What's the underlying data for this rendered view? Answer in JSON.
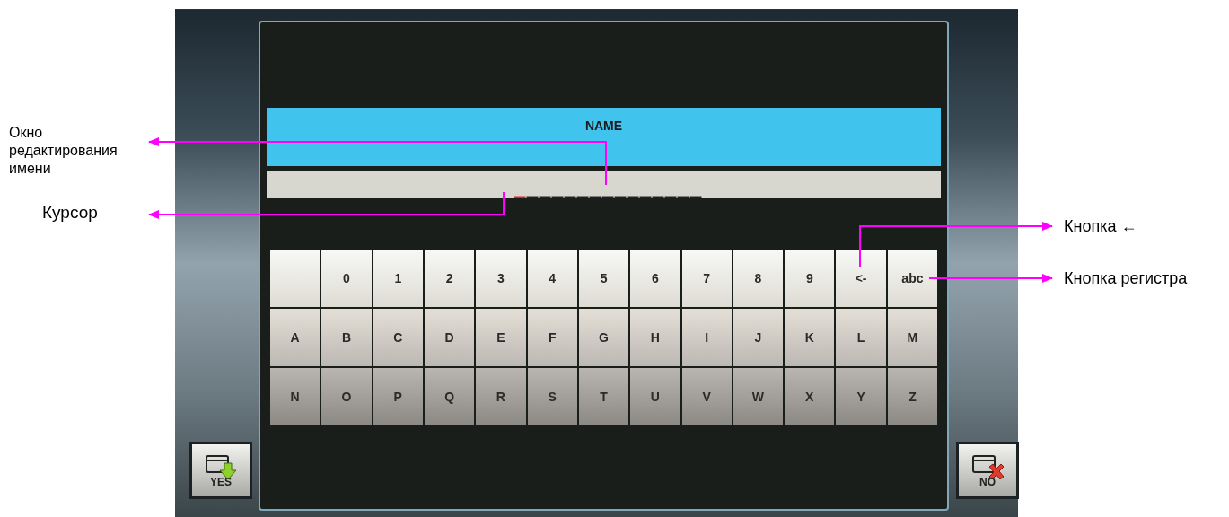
{
  "name_panel": {
    "title": "NAME",
    "cursor": "_",
    "value": "______________"
  },
  "keyboard": {
    "rows": [
      {
        "keys": [
          {
            "kind": "blank"
          },
          {
            "kind": "key",
            "label": "0"
          },
          {
            "kind": "key",
            "label": "1"
          },
          {
            "kind": "key",
            "label": "2"
          },
          {
            "kind": "key",
            "label": "3"
          },
          {
            "kind": "key",
            "label": "4"
          },
          {
            "kind": "key",
            "label": "5"
          },
          {
            "kind": "key",
            "label": "6"
          },
          {
            "kind": "key",
            "label": "7"
          },
          {
            "kind": "key",
            "label": "8"
          },
          {
            "kind": "key",
            "label": "9"
          },
          {
            "kind": "key",
            "label": "<-"
          },
          {
            "kind": "key",
            "label": "abc"
          }
        ]
      },
      {
        "keys": [
          {
            "kind": "key",
            "label": "A"
          },
          {
            "kind": "key",
            "label": "B"
          },
          {
            "kind": "key",
            "label": "C"
          },
          {
            "kind": "key",
            "label": "D"
          },
          {
            "kind": "key",
            "label": "E"
          },
          {
            "kind": "key",
            "label": "F"
          },
          {
            "kind": "key",
            "label": "G"
          },
          {
            "kind": "key",
            "label": "H"
          },
          {
            "kind": "key",
            "label": "I"
          },
          {
            "kind": "key",
            "label": "J"
          },
          {
            "kind": "key",
            "label": "K"
          },
          {
            "kind": "key",
            "label": "L"
          },
          {
            "kind": "key",
            "label": "M"
          }
        ]
      },
      {
        "keys": [
          {
            "kind": "key",
            "label": "N"
          },
          {
            "kind": "key",
            "label": "O"
          },
          {
            "kind": "key",
            "label": "P"
          },
          {
            "kind": "key",
            "label": "Q"
          },
          {
            "kind": "key",
            "label": "R"
          },
          {
            "kind": "key",
            "label": "S"
          },
          {
            "kind": "key",
            "label": "T"
          },
          {
            "kind": "key",
            "label": "U"
          },
          {
            "kind": "key",
            "label": "V"
          },
          {
            "kind": "key",
            "label": "W"
          },
          {
            "kind": "key",
            "label": "X"
          },
          {
            "kind": "key",
            "label": "Y"
          },
          {
            "kind": "key",
            "label": "Z"
          }
        ]
      }
    ]
  },
  "buttons": [
    {
      "kind": "confirm",
      "label": "YES"
    },
    {
      "kind": "cancel",
      "label": "NO"
    }
  ],
  "left_annotations": [
    "Окно редактирования имени",
    "Курсор"
  ],
  "right_annotations": [
    "Кнопка ←",
    "Кнопка регистра"
  ]
}
